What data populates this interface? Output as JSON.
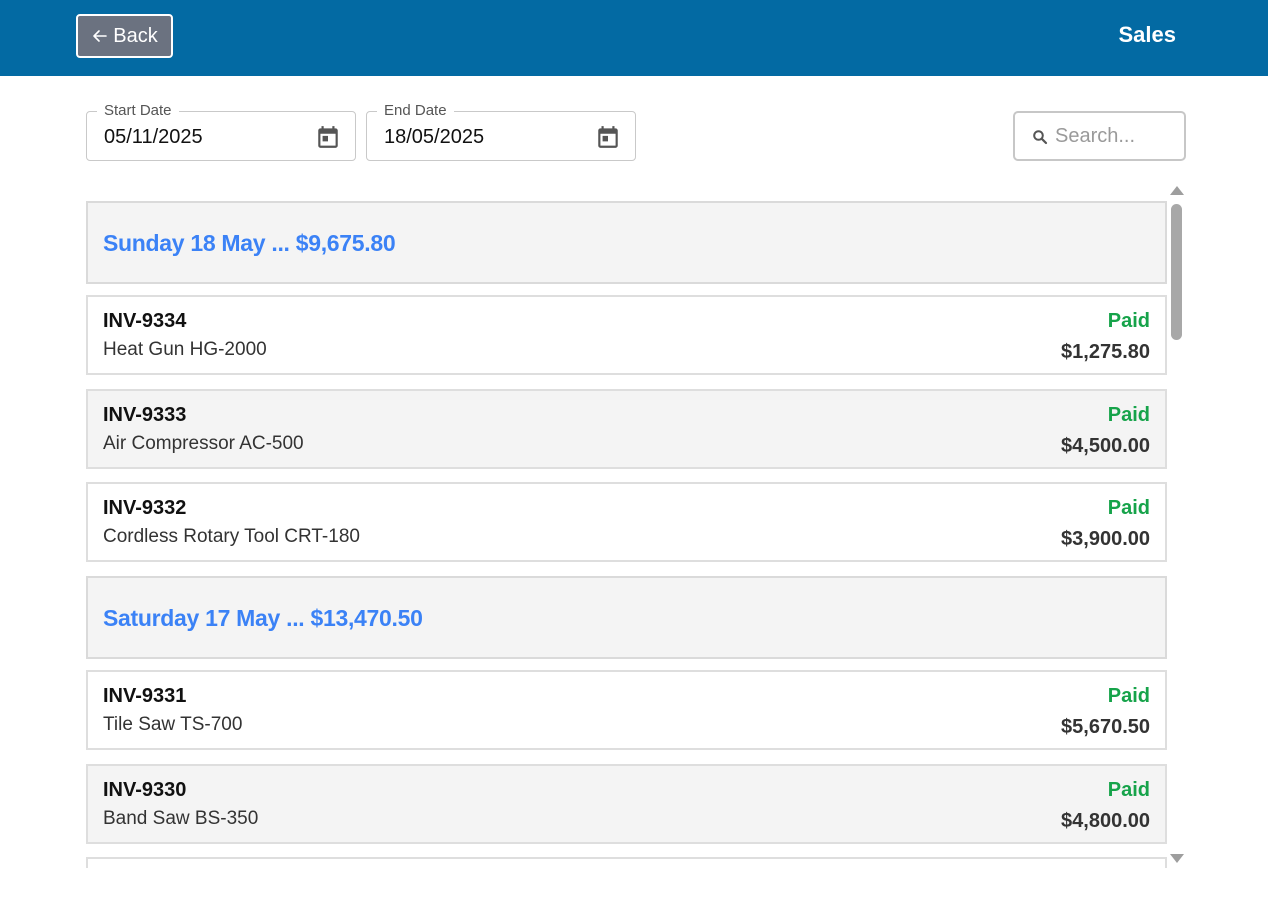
{
  "header": {
    "back_label": "Back",
    "title": "Sales"
  },
  "filters": {
    "start_label": "Start Date",
    "start_value": "05/11/2025",
    "end_label": "End Date",
    "end_value": "18/05/2025",
    "search_placeholder": "Search..."
  },
  "groups": [
    {
      "title": "Sunday 18 May ... $9,675.80",
      "invoices": [
        {
          "id": "INV-9334",
          "product": "Heat Gun HG-2000",
          "status": "Paid",
          "amount": "$1,275.80"
        },
        {
          "id": "INV-9333",
          "product": "Air Compressor AC-500",
          "status": "Paid",
          "amount": "$4,500.00"
        },
        {
          "id": "INV-9332",
          "product": "Cordless Rotary Tool CRT-180",
          "status": "Paid",
          "amount": "$3,900.00"
        }
      ]
    },
    {
      "title": "Saturday 17 May ... $13,470.50",
      "invoices": [
        {
          "id": "INV-9331",
          "product": "Tile Saw TS-700",
          "status": "Paid",
          "amount": "$5,670.50"
        },
        {
          "id": "INV-9330",
          "product": "Band Saw BS-350",
          "status": "Paid",
          "amount": "$4,800.00"
        }
      ]
    }
  ],
  "colors": {
    "header_bg": "#036aa3",
    "group_title": "#3b82f6",
    "paid": "#16a34a"
  }
}
